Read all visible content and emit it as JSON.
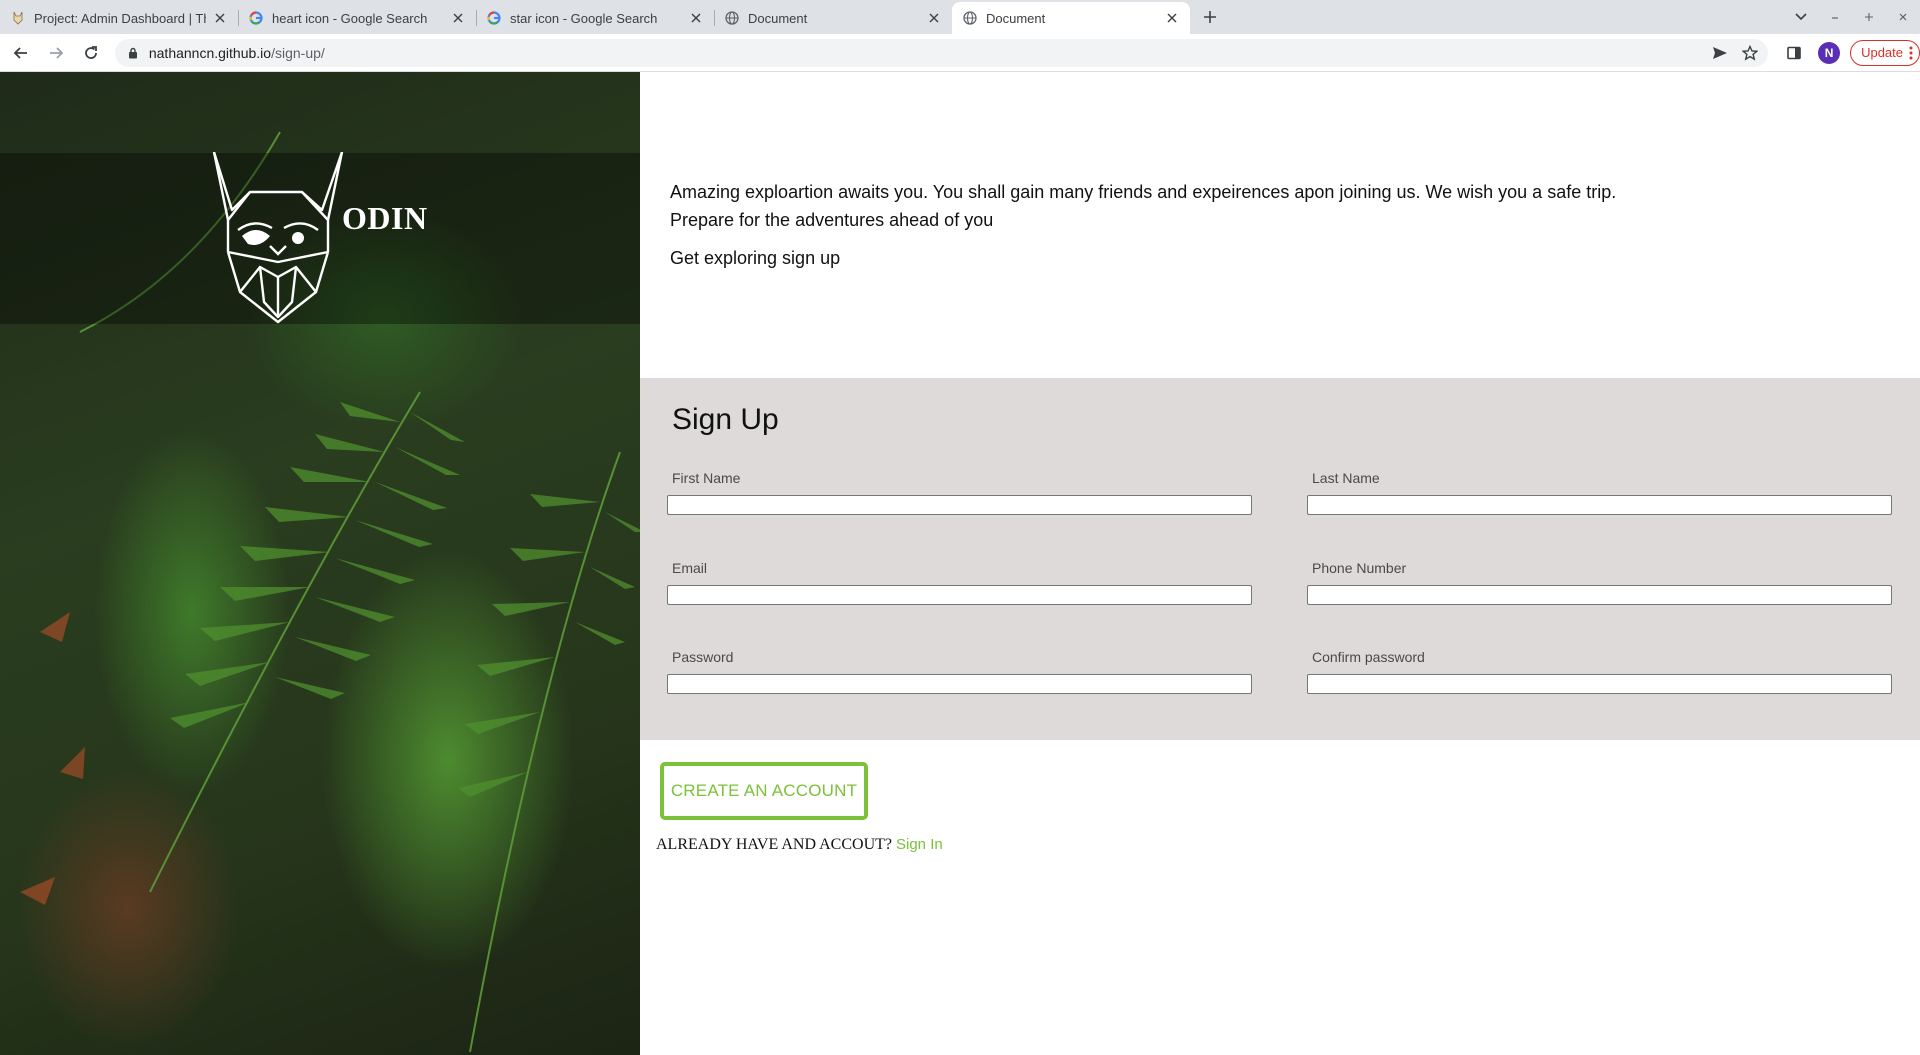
{
  "browser": {
    "tabs": [
      {
        "title": "Project: Admin Dashboard | Th",
        "favicon": "odin-favicon",
        "active": false
      },
      {
        "title": "heart icon - Google Search",
        "favicon": "google-icon",
        "active": false
      },
      {
        "title": "star icon - Google Search",
        "favicon": "google-icon",
        "active": false
      },
      {
        "title": "Document",
        "favicon": "globe-icon",
        "active": false
      },
      {
        "title": "Document",
        "favicon": "globe-icon",
        "active": true
      }
    ],
    "url_host": "nathanncn.github.io",
    "url_path": "/sign-up/",
    "avatar_letter": "N",
    "update_label": "Update"
  },
  "hero": {
    "logo_text": "ODIN"
  },
  "intro": {
    "line1": "Amazing exploartion awaits you. You shall gain many friends and expeirences apon joining us. We wish you a safe trip.",
    "line2": "Prepare for the adventures ahead of you",
    "cta": "Get exploring sign up"
  },
  "signup": {
    "title": "Sign Up",
    "fields": [
      {
        "label": "First Name",
        "value": ""
      },
      {
        "label": "Last Name",
        "value": ""
      },
      {
        "label": "Email",
        "value": ""
      },
      {
        "label": "Phone Number",
        "value": ""
      },
      {
        "label": "Password",
        "value": ""
      },
      {
        "label": "Confirm password",
        "value": ""
      }
    ],
    "create_button": "CREATE AN ACCOUNT",
    "already_text": "ALREADY HAVE AND ACCOUT?",
    "signin_link": "Sign In"
  },
  "colors": {
    "accent": "#7cc13a",
    "form_bg": "#dddad9",
    "update_red": "#d93025"
  }
}
